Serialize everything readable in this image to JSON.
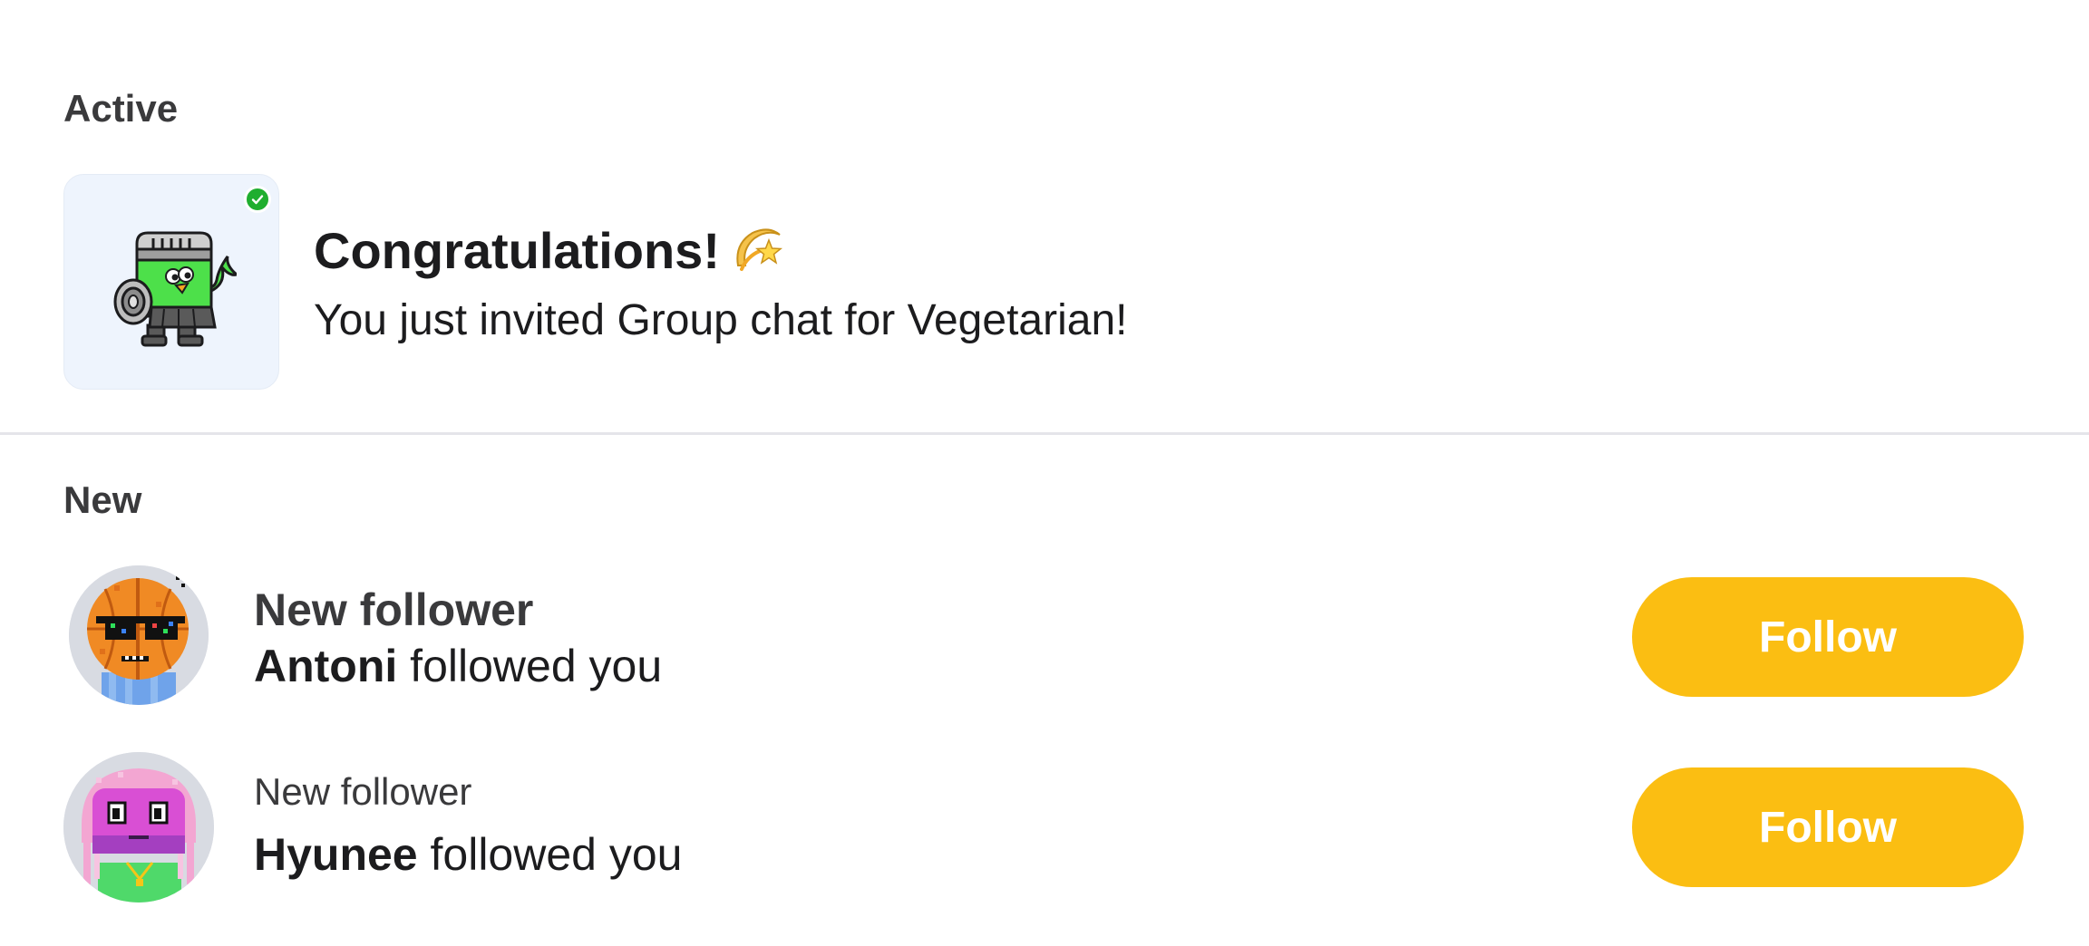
{
  "sections": {
    "active": {
      "title": "Active"
    },
    "new": {
      "title": "New"
    }
  },
  "active_card": {
    "title": "Congratulations!",
    "title_emoji_icon": "dizzy-sparkle-icon",
    "message": "You just invited Group chat for Vegetarian!",
    "badge_icon": "check-icon",
    "colors": {
      "card_bg": "#eef4fd",
      "badge": "#1fae2f"
    }
  },
  "notifications": [
    {
      "title": "New follower",
      "name": "Antoni",
      "action": " followed you",
      "button_label": "Follow"
    },
    {
      "title": "New follower",
      "name": "Hyunee",
      "action": " followed you",
      "button_label": "Follow"
    }
  ],
  "colors": {
    "accent": "#fbbe12",
    "divider": "#e5e5ea",
    "text_primary": "#1c1c1e",
    "text_secondary": "#3a3a3c"
  }
}
